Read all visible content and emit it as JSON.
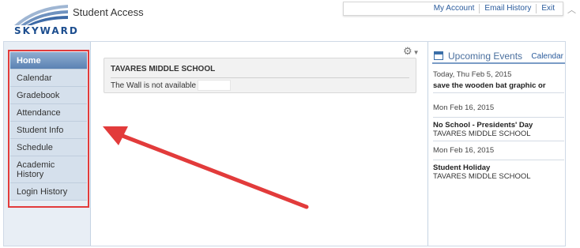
{
  "header": {
    "logo_text": "SKYWARD",
    "app_title": "Student Access",
    "links": [
      "My Account",
      "Email History",
      "Exit"
    ]
  },
  "sidebar": {
    "items": [
      {
        "label": "Home",
        "active": true
      },
      {
        "label": "Calendar"
      },
      {
        "label": "Gradebook"
      },
      {
        "label": "Attendance"
      },
      {
        "label": "Student Info"
      },
      {
        "label": "Schedule"
      },
      {
        "label": "Academic\nHistory"
      },
      {
        "label": "Login History"
      }
    ]
  },
  "wall": {
    "school": "TAVARES MIDDLE SCHOOL",
    "message": "The Wall is not available for"
  },
  "events": {
    "title": "Upcoming Events",
    "calendar_link": "Calendar",
    "items": [
      {
        "date": "Today, Thu Feb 5, 2015",
        "name": "save the wooden bat graphic or",
        "location": ""
      },
      {
        "date": "Mon Feb 16, 2015",
        "name": "No School - Presidents' Day",
        "location": "TAVARES MIDDLE SCHOOL"
      },
      {
        "date": "Mon Feb 16, 2015",
        "name": "Student Holiday",
        "location": "TAVARES MIDDLE SCHOOL"
      }
    ]
  },
  "icons": {
    "settings": "gear-icon",
    "calendar": "calendar-icon",
    "scroll": "scroll-up-icon"
  },
  "colors": {
    "annotation_red": "#e23b3b",
    "nav_active": "#5b82b3",
    "link_blue": "#2a5b9c"
  }
}
